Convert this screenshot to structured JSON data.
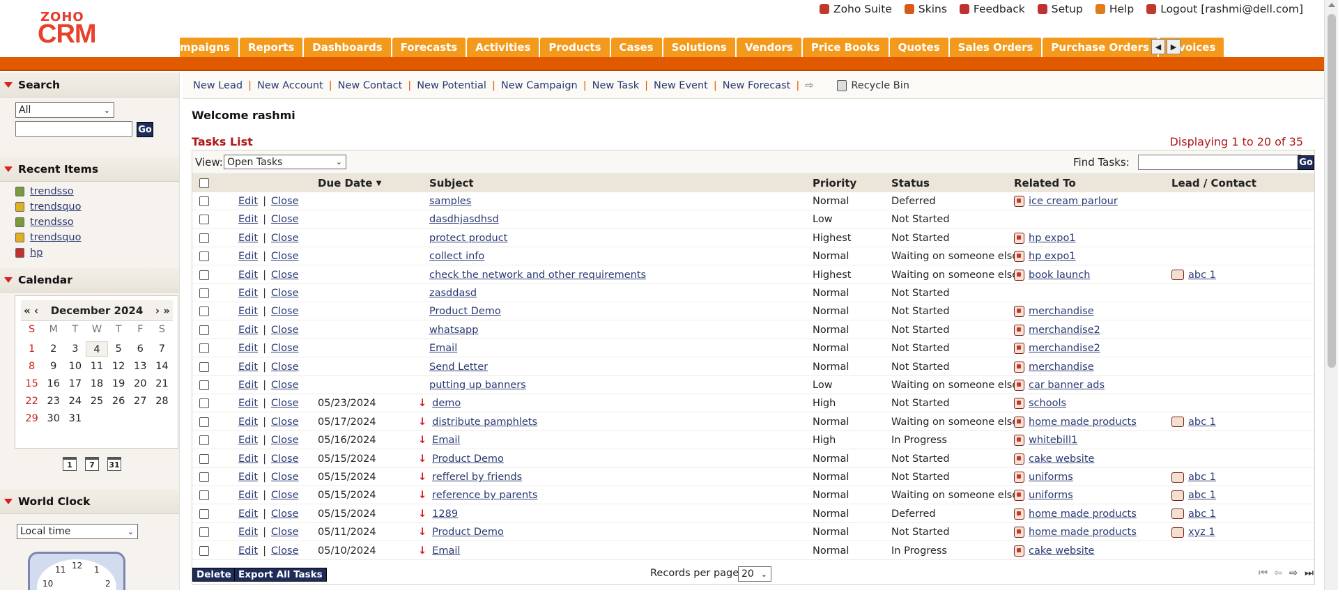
{
  "header": {
    "logo_top": "ZOHO",
    "logo_main": "CRM",
    "top_links": [
      "Zoho Suite",
      "Skins",
      "Feedback",
      "Setup",
      "Help",
      "Logout [rashmi@dell.com]"
    ],
    "tabs": [
      "mpaigns",
      "Reports",
      "Dashboards",
      "Forecasts",
      "Activities",
      "Products",
      "Cases",
      "Solutions",
      "Vendors",
      "Price Books",
      "Quotes",
      "Sales Orders",
      "Purchase Orders",
      "Invoices"
    ]
  },
  "sidebar": {
    "search": {
      "title": "Search",
      "select_value": "All",
      "go": "Go"
    },
    "recent": {
      "title": "Recent Items",
      "items": [
        "trendsso",
        "trendsquo",
        "trendsso",
        "trendsquo",
        "hp"
      ]
    },
    "calendar": {
      "title": "Calendar",
      "month": "December 2024",
      "nav_prev": "« ‹",
      "nav_next": "› »",
      "days_of_week": [
        "S",
        "M",
        "T",
        "W",
        "T",
        "F",
        "S"
      ],
      "today": "4",
      "view_icons": [
        "1",
        "7",
        "31"
      ]
    },
    "world_clock": {
      "title": "World Clock",
      "select_value": "Local time"
    }
  },
  "quickbar": {
    "links": [
      "New Lead",
      "New Account",
      "New Contact",
      "New Potential",
      "New Campaign",
      "New Task",
      "New Event",
      "New Forecast"
    ],
    "recycle": "Recycle Bin"
  },
  "main": {
    "welcome": "Welcome rashmi",
    "list_title": "Tasks List",
    "displaying": "Displaying 1 to 20 of 35",
    "view_label": "View:",
    "view_value": "Open Tasks",
    "find_label": "Find Tasks:",
    "find_go": "Go",
    "columns": [
      "Due Date",
      "Subject",
      "Priority",
      "Status",
      "Related To",
      "Lead / Contact"
    ],
    "edit": "Edit",
    "close": "Close",
    "rows": [
      {
        "due": "",
        "subject": "samples",
        "priority": "Normal",
        "status": "Deferred",
        "related": "ice cream parlour",
        "lead": ""
      },
      {
        "due": "",
        "subject": "dasdhjasdhsd",
        "priority": "Low",
        "status": "Not Started",
        "related": "",
        "lead": ""
      },
      {
        "due": "",
        "subject": "protect product",
        "priority": "Highest",
        "status": "Not Started",
        "related": "hp expo1",
        "lead": ""
      },
      {
        "due": "",
        "subject": "collect info",
        "priority": "Normal",
        "status": "Waiting on someone else",
        "related": "hp expo1",
        "lead": ""
      },
      {
        "due": "",
        "subject": "check the network and other requirements",
        "priority": "Highest",
        "status": "Waiting on someone else",
        "related": "book launch",
        "lead": "abc 1"
      },
      {
        "due": "",
        "subject": "zasddasd",
        "priority": "Normal",
        "status": "Not Started",
        "related": "",
        "lead": ""
      },
      {
        "due": "",
        "subject": "Product Demo",
        "priority": "Normal",
        "status": "Not Started",
        "related": "merchandise",
        "lead": ""
      },
      {
        "due": "",
        "subject": "whatsapp",
        "priority": "Normal",
        "status": "Not Started",
        "related": "merchandise2",
        "lead": ""
      },
      {
        "due": "",
        "subject": "Email",
        "priority": "Normal",
        "status": "Not Started",
        "related": "merchandise2",
        "lead": ""
      },
      {
        "due": "",
        "subject": "Send Letter",
        "priority": "Normal",
        "status": "Not Started",
        "related": "merchandise",
        "lead": ""
      },
      {
        "due": "",
        "subject": "putting up banners",
        "priority": "Low",
        "status": "Waiting on someone else",
        "related": "car banner ads",
        "lead": ""
      },
      {
        "due": "05/23/2024",
        "subject": "demo",
        "priority": "High",
        "status": "Not Started",
        "related": "schools",
        "lead": ""
      },
      {
        "due": "05/17/2024",
        "subject": "distribute pamphlets",
        "priority": "Normal",
        "status": "Waiting on someone else",
        "related": "home made products",
        "lead": "abc 1"
      },
      {
        "due": "05/16/2024",
        "subject": "Email",
        "priority": "High",
        "status": "In Progress",
        "related": "whitebill1",
        "lead": ""
      },
      {
        "due": "05/15/2024",
        "subject": "Product Demo",
        "priority": "Normal",
        "status": "Not Started",
        "related": "cake website",
        "lead": ""
      },
      {
        "due": "05/15/2024",
        "subject": "refferel by friends",
        "priority": "Normal",
        "status": "Not Started",
        "related": "uniforms",
        "lead": "abc 1"
      },
      {
        "due": "05/15/2024",
        "subject": "reference by parents",
        "priority": "Normal",
        "status": "Waiting on someone else",
        "related": "uniforms",
        "lead": "abc 1"
      },
      {
        "due": "05/15/2024",
        "subject": "1289",
        "priority": "Normal",
        "status": "Deferred",
        "related": "home made products",
        "lead": "abc 1"
      },
      {
        "due": "05/11/2024",
        "subject": "Product Demo",
        "priority": "Normal",
        "status": "Not Started",
        "related": "home made products",
        "lead": "xyz 1"
      },
      {
        "due": "05/10/2024",
        "subject": "Email",
        "priority": "Normal",
        "status": "In Progress",
        "related": "cake website",
        "lead": ""
      }
    ],
    "footer": {
      "delete": "Delete",
      "export": "Export All Tasks",
      "records_label": "Records per page",
      "records_value": "20"
    }
  },
  "colors": {
    "tab_orange": "#f39a1c",
    "bar_orange": "#e15a00",
    "title_red": "#b01818",
    "link_blue": "#2b3a73",
    "button_navy": "#1d2c5a"
  }
}
